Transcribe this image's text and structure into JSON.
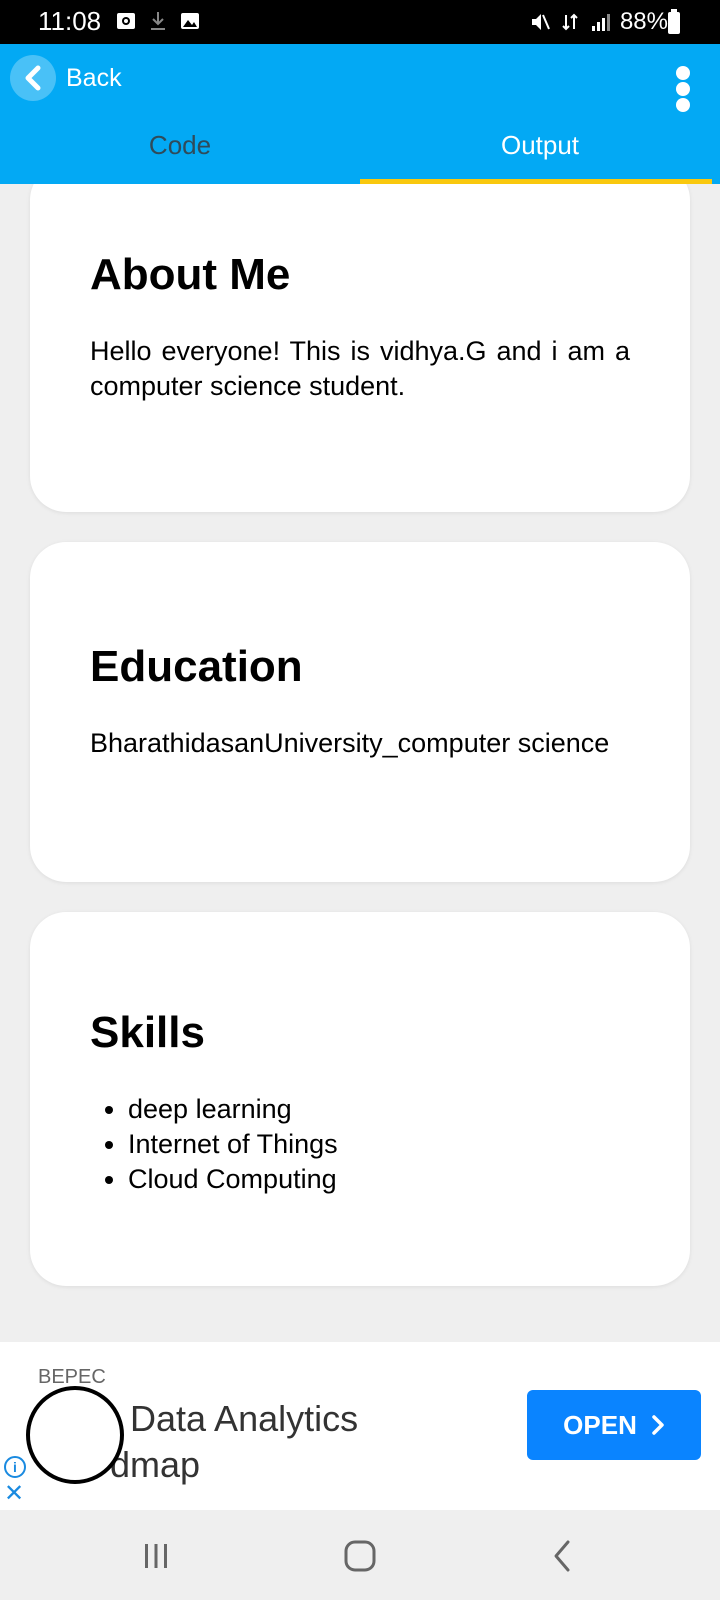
{
  "status_bar": {
    "time": "11:08",
    "battery_text": "88%"
  },
  "app_bar": {
    "back_label": "Back",
    "tabs": [
      {
        "label": "Code",
        "active": false
      },
      {
        "label": "Output",
        "active": true
      }
    ],
    "accent_color": "#03a9f4",
    "indicator_color": "#f9c80e"
  },
  "sections": {
    "about": {
      "heading": "About Me",
      "text": "Hello everyone! This is vidhya.G and i am a computer science student."
    },
    "education": {
      "heading": "Education",
      "text": "BharathidasanUniversity_computer science"
    },
    "skills": {
      "heading": "Skills",
      "items": [
        "deep learning",
        "Internet of Things",
        "Cloud Computing"
      ]
    }
  },
  "ad": {
    "advertiser": "BEPEC",
    "title_line1": "Data Analytics",
    "title_line2": "dmap",
    "button_label": "OPEN",
    "button_color": "#0a84ff"
  },
  "nav_bar": {
    "icons": [
      "recent-apps-icon",
      "home-icon",
      "back-nav-icon"
    ]
  }
}
